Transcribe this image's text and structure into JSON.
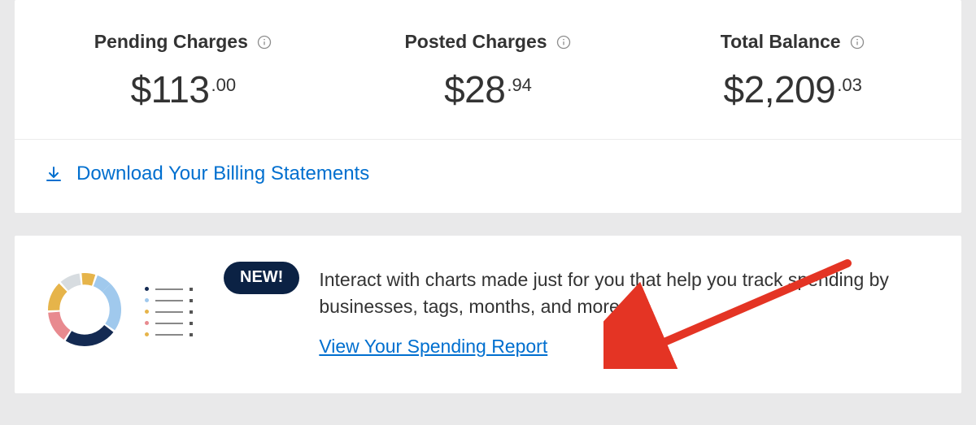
{
  "balances": {
    "pending": {
      "label": "Pending Charges",
      "main": "$113",
      "cents": ".00"
    },
    "posted": {
      "label": "Posted Charges",
      "main": "$28",
      "cents": ".94"
    },
    "total": {
      "label": "Total Balance",
      "main": "$2,209",
      "cents": ".03"
    }
  },
  "download_link": "Download Your Billing Statements",
  "promo": {
    "badge": "NEW!",
    "copy": "Interact with charts made just for you that help you track spending by businesses, tags, months, and more.",
    "link": "View Your Spending Report"
  },
  "colors": {
    "link": "#006fcf",
    "badge_bg": "#0b2244",
    "donut": [
      "#a0c9ed",
      "#142a52",
      "#e6b44a",
      "#e88a8f",
      "#d7dce0",
      "#e6b44a",
      "#a0c9ed"
    ]
  }
}
